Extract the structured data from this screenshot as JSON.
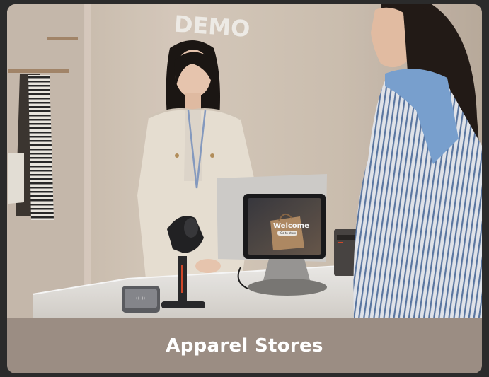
{
  "card": {
    "sign_text": "DEMO",
    "screen_text": "Welcome",
    "caption": "Apparel Stores"
  },
  "colors": {
    "caption_bg": "#9b8d83",
    "wall": "#d8cbbd",
    "counter": "#eeece8"
  }
}
